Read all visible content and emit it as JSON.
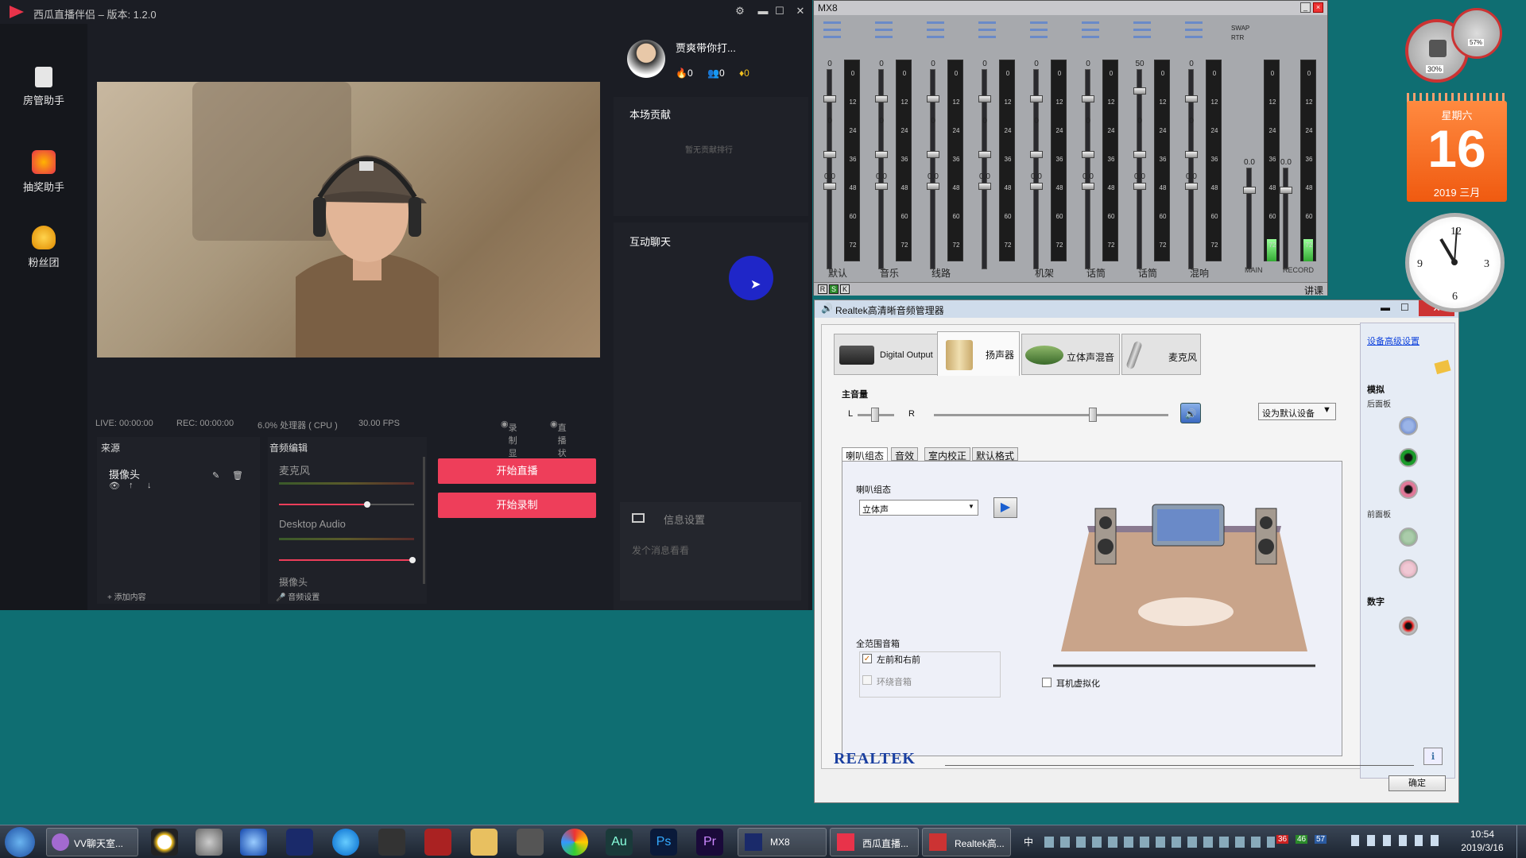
{
  "app": {
    "title": "西瓜直播伴侣 – 版本: 1.2.0",
    "sidebar": [
      {
        "label": "房管助手",
        "icon": "clipboard-user-icon"
      },
      {
        "label": "抽奖助手",
        "icon": "lottery-icon"
      },
      {
        "label": "粉丝团",
        "icon": "fan-club-icon"
      }
    ],
    "status": {
      "live": "LIVE: 00:00:00",
      "rec": "REC: 00:00:00",
      "cpu": "6.0% 处理器 ( CPU )",
      "fps": "30.00 FPS",
      "record_display": "录制显示",
      "live_status": "直播状态"
    },
    "sources": {
      "header": "来源",
      "items": [
        "摄像头"
      ],
      "add": "添加内容"
    },
    "audio": {
      "header": "音频编辑",
      "channels": [
        {
          "name": "麦克风",
          "level": 0.8
        },
        {
          "name": "Desktop Audio",
          "level": 1.0
        },
        {
          "name": "摄像头"
        }
      ],
      "settings": "音频设置"
    },
    "buttons": {
      "start_live": "开始直播",
      "start_record": "开始录制"
    },
    "user": {
      "name": "贾爽带你打...",
      "fire": "0",
      "followers": "0",
      "diamonds": "0"
    },
    "contribution": {
      "title": "本场贡献",
      "empty": "暂无贡献排行"
    },
    "chat": {
      "title": "互动聊天",
      "settings": "信息设置",
      "input_placeholder": "发个消息看看"
    }
  },
  "mx8": {
    "title": "MX8",
    "channels": [
      {
        "name": "默认",
        "top_val": "0",
        "mid_val": "0",
        "low_val": "0.0"
      },
      {
        "name": "音乐",
        "top_val": "0",
        "mid_val": "0",
        "low_val": "0.0"
      },
      {
        "name": "线路",
        "top_val": "0",
        "mid_val": "0",
        "low_val": "0.0"
      },
      {
        "name": "",
        "top_val": "0",
        "mid_val": "0",
        "low_val": "0.0"
      },
      {
        "name": "机架",
        "top_val": "0",
        "mid_val": "0",
        "low_val": "0.0"
      },
      {
        "name": "话筒",
        "top_val": "0",
        "mid_val": "0",
        "low_val": "0.0"
      },
      {
        "name": "话筒",
        "top_val": "50",
        "mid_val": "0",
        "low_val": "0.0"
      },
      {
        "name": "混响",
        "top_val": "0",
        "mid_val": "0",
        "low_val": "0.0"
      }
    ],
    "main_label": "MAIN",
    "record_label": "RECORD",
    "main_val": "0.0",
    "record_val": "0.0",
    "meter_ticks": [
      "0",
      "12",
      "24",
      "36",
      "48",
      "60",
      "72"
    ],
    "swap": "SWAP",
    "rtr": "RTR",
    "bottom_right": "讲课",
    "bottom_buttons": [
      "R",
      "S",
      "K"
    ]
  },
  "realtek": {
    "title": "Realtek高清晰音频管理器",
    "tabs": [
      "Digital Output",
      "扬声器",
      "立体声混音",
      "麦克风"
    ],
    "advanced_link": "设备高级设置",
    "main_volume": "主音量",
    "l": "L",
    "r": "R",
    "default_device": "设为默认设备",
    "subtabs": [
      "喇叭组态",
      "音效",
      "室内校正",
      "默认格式"
    ],
    "speaker_config_label": "喇叭组态",
    "speaker_config_value": "立体声",
    "fullrange_title": "全范围音箱",
    "front_lr": "左前和右前",
    "surround": "环绕音箱",
    "headphone_virt": "耳机虚拟化",
    "analog": "模拟",
    "back_panel": "后面板",
    "front_panel": "前面板",
    "digital": "数字",
    "brand": "REALTEK",
    "ok": "确定"
  },
  "gadgets": {
    "weekday": "星期六",
    "day": "16",
    "month": "2019 三月",
    "cpu": "30%",
    "mem": "57%"
  },
  "taskbar": {
    "items": [
      {
        "label": "VV聊天室..."
      },
      {
        "label": "MX8"
      },
      {
        "label": "西瓜直播..."
      },
      {
        "label": "Realtek高..."
      }
    ],
    "tray_numbers": [
      "36",
      "46",
      "57"
    ],
    "ime": "中",
    "time": "10:54",
    "date": "2019/3/16"
  }
}
